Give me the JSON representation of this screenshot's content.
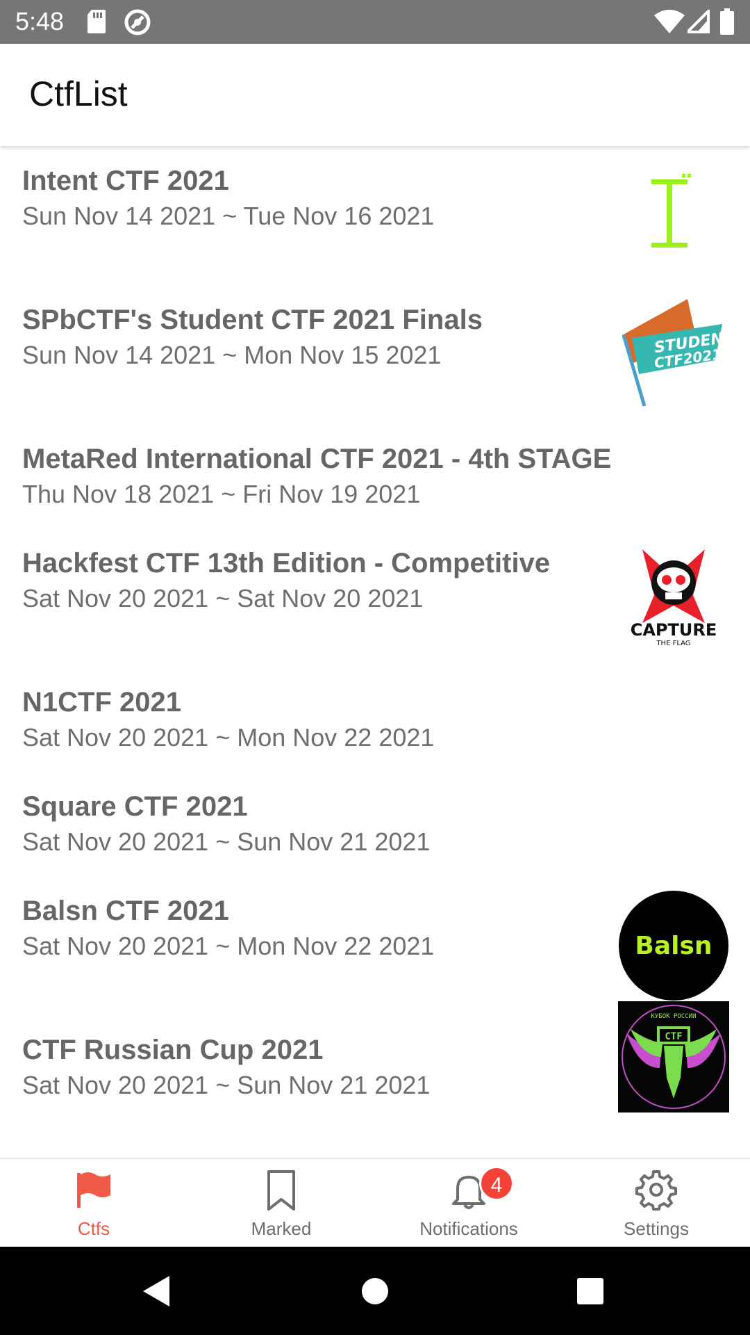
{
  "status_bar": {
    "time": "5:48",
    "icons": [
      "sd-card-icon",
      "no-disturb-icon",
      "wifi-icon",
      "signal-icon",
      "battery-icon"
    ]
  },
  "app_bar": {
    "title": "CtfList"
  },
  "ctfs": [
    {
      "name": "Intent CTF 2021",
      "dates": "Sun Nov 14 2021 ~ Tue Nov 16 2021",
      "logo": "intent-logo"
    },
    {
      "name": "SPbCTF's Student CTF 2021 Finals",
      "dates": "Sun Nov 14 2021 ~ Mon Nov 15 2021",
      "logo": "student-ctf-logo",
      "logo_text": "STUDENT CTF2021"
    },
    {
      "name": "MetaRed International CTF 2021 - 4th STAGE",
      "dates": "Thu Nov 18 2021 ~ Fri Nov 19 2021",
      "logo": ""
    },
    {
      "name": "Hackfest CTF 13th Edition - Competitive",
      "dates": "Sat Nov 20 2021 ~ Sat Nov 20 2021",
      "logo": "hackfest-logo",
      "logo_text": "CAPTURE THE FLAG"
    },
    {
      "name": "N1CTF 2021",
      "dates": "Sat Nov 20 2021 ~ Mon Nov 22 2021",
      "logo": ""
    },
    {
      "name": "Square CTF 2021",
      "dates": "Sat Nov 20 2021 ~ Sun Nov 21 2021",
      "logo": ""
    },
    {
      "name": "Balsn CTF 2021",
      "dates": "Sat Nov 20 2021 ~ Mon Nov 22 2021",
      "logo": "balsn-logo",
      "logo_text": "Balsn"
    },
    {
      "name": "CTF Russian Cup 2021",
      "dates": "Sat Nov 20 2021 ~ Sun Nov 21 2021",
      "logo": "russian-cup-logo",
      "logo_text": "КУБОК РОССИИ CTF"
    }
  ],
  "bottom_nav": {
    "items": [
      {
        "label": "Ctfs",
        "icon": "flag-icon",
        "active": true
      },
      {
        "label": "Marked",
        "icon": "bookmark-icon",
        "active": false
      },
      {
        "label": "Notifications",
        "icon": "bell-icon",
        "active": false,
        "badge": "4"
      },
      {
        "label": "Settings",
        "icon": "gear-icon",
        "active": false
      }
    ]
  },
  "colors": {
    "accent": "#f05a46",
    "status_bar": "#767676",
    "badge": "#f44336",
    "text_gray": "#666666"
  }
}
